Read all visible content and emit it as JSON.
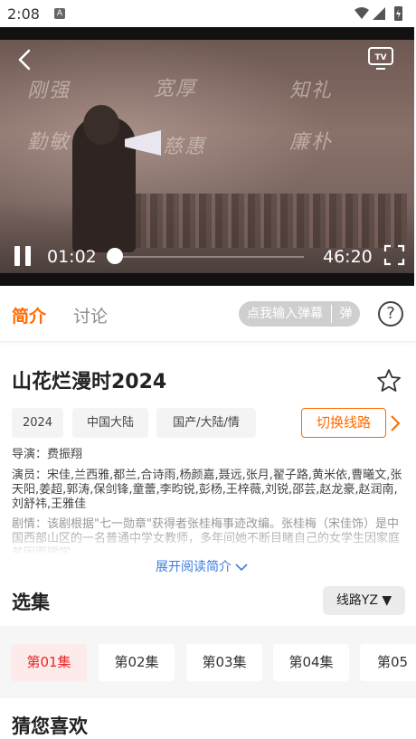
{
  "status_bar": {
    "time": "2:08",
    "notif": "A"
  },
  "player": {
    "calligraphy": [
      "刚强",
      "宽厚",
      "知礼",
      "勤敏",
      "慈惠",
      "廉朴"
    ],
    "current_time": "01:02",
    "total_time": "46:20",
    "progress": 0.022
  },
  "tabs": [
    {
      "label": "简介",
      "active": true
    },
    {
      "label": "讨论",
      "active": false
    }
  ],
  "danmu": {
    "placeholder": "点我输入弹幕",
    "button": "弹"
  },
  "help_label": "?",
  "detail": {
    "title": "山花烂漫时2024",
    "tags": [
      "2024",
      "中国大陆",
      "国产/大陆/情"
    ],
    "switch_label": "切换线路",
    "director": "导演：费振翔",
    "cast": "演员：宋佳,兰西雅,都兰,合诗雨,杨颜嘉,聂远,张月,翟子路,黄米依,曹曦文,张天阳,姜超,郭涛,保剑锋,童蕾,李昀锐,彭杨,王梓薇,刘锐,邵芸,赵龙豪,赵润南,刘舒祎,王雅佳",
    "plot": "剧情：该剧根据\"七一勋章\"获得者张桂梅事迹改编。张桂梅（宋佳饰）是中国西部山区的一名普通中学女教师，多年间她不断目睹自己的女学生因家庭贫困而辍学，",
    "expand_label": "展开阅读简介"
  },
  "episodes_section": {
    "title": "选集",
    "line_label": "线路YZ ▼",
    "episodes": [
      "第01集",
      "第02集",
      "第03集",
      "第04集",
      "第05"
    ]
  },
  "recommend_title": "猜您喜欢",
  "colors": {
    "accent": "#ff6a00",
    "active_episode": "#e82828",
    "link": "#3a7de0"
  }
}
